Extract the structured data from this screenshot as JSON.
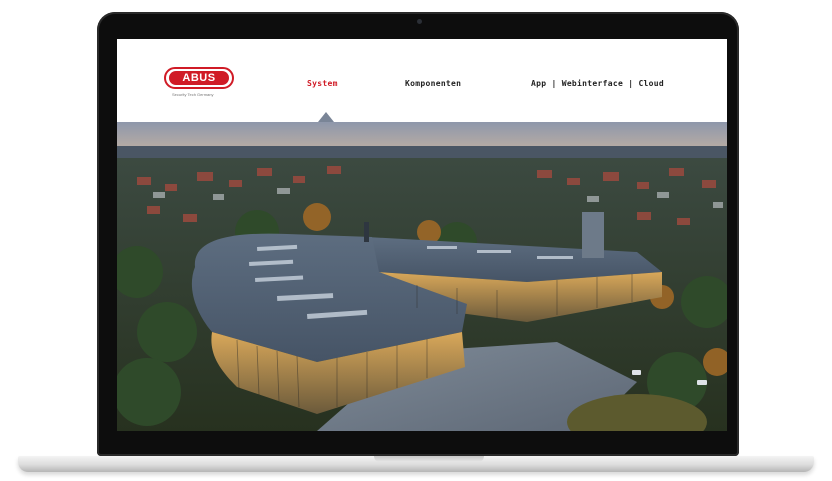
{
  "brand": {
    "name": "ABUS",
    "tagline": "Security Tech Germany",
    "accent_color": "#d01b26"
  },
  "nav": {
    "items": [
      {
        "label": "System",
        "active": true
      },
      {
        "label": "Komponenten",
        "active": false
      },
      {
        "label": "App | Webinterface | Cloud",
        "active": false
      }
    ]
  },
  "hero": {
    "description": "Aerial photo of a curved glass-facade office building with flat roofs at dusk, surrounded by autumn trees and a residential town"
  }
}
